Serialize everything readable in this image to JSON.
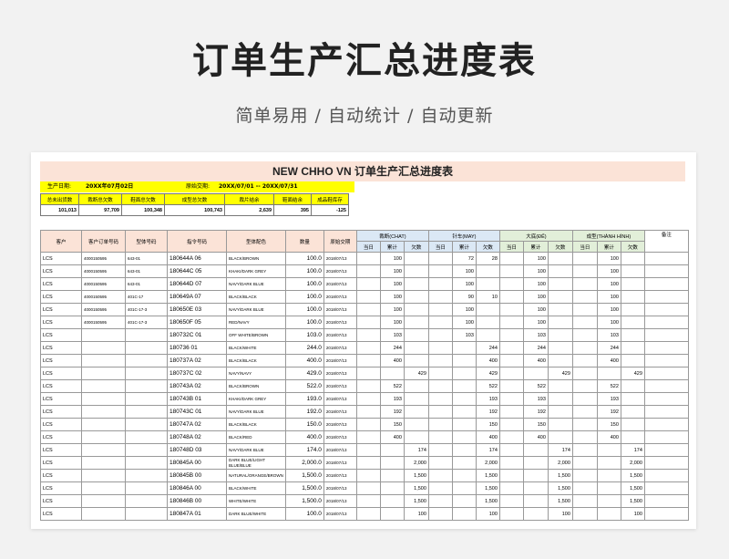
{
  "header": {
    "title": "订单生产汇总进度表",
    "subtitle": "简单易用  /  自动统计  /  自动更新"
  },
  "sheet": {
    "title": "NEW CHHO VN 订单生产汇总进度表",
    "info": {
      "date_label": "生产日期:",
      "date_value": "20XX年07月02日",
      "period_label": "原始交期:",
      "period_value": "20XX/07/01 -- 20XX/07/31"
    },
    "summary": {
      "headers": [
        "总未出货数",
        "裁断总欠数",
        "鞋面总欠数",
        "成型总欠数",
        "裁片结余",
        "鞋面结余",
        "成品鞋库存"
      ],
      "values": [
        "101,013",
        "97,709",
        "100,348",
        "100,743",
        "2,639",
        "395",
        "-125"
      ]
    },
    "table": {
      "headers": [
        "客户",
        "客户订单号码",
        "型体号码",
        "指令号码",
        "型体配色",
        "数量",
        "原始交期"
      ],
      "group_headers": [
        "裁断(CHAT)",
        "针车(MAY)",
        "大底(ĐẾ)",
        "成型(THÀNH HÌNH)"
      ],
      "last_header": "备注",
      "sub_headers": [
        "当日",
        "累计",
        "欠数"
      ],
      "rows": [
        {
          "customer": "LCS",
          "cust_po": "4000150595",
          "style": "643-01",
          "order": "180644A 06",
          "color": "BLACK/BROWN",
          "qty": "100.0",
          "date": "2018/07/13",
          "c": [
            "",
            "100",
            ""
          ],
          "m": [
            "",
            "72",
            "28"
          ],
          "d": [
            "",
            "100",
            ""
          ],
          "t": [
            "",
            "100",
            ""
          ]
        },
        {
          "customer": "LCS",
          "cust_po": "4000150595",
          "style": "643-01",
          "order": "180644C 05",
          "color": "KHAKI/DARK GREY",
          "qty": "100.0",
          "date": "2018/07/13",
          "c": [
            "",
            "100",
            ""
          ],
          "m": [
            "",
            "100",
            ""
          ],
          "d": [
            "",
            "100",
            ""
          ],
          "t": [
            "",
            "100",
            ""
          ]
        },
        {
          "customer": "LCS",
          "cust_po": "4000150595",
          "style": "643-01",
          "order": "180644D 07",
          "color": "NAVY/DARK BLUE",
          "qty": "100.0",
          "date": "2018/07/13",
          "c": [
            "",
            "100",
            ""
          ],
          "m": [
            "",
            "100",
            ""
          ],
          "d": [
            "",
            "100",
            ""
          ],
          "t": [
            "",
            "100",
            ""
          ]
        },
        {
          "customer": "LCS",
          "cust_po": "4000150595",
          "style": "401C-17",
          "order": "180649A 07",
          "color": "BLACK/BLACK",
          "qty": "100.0",
          "date": "2018/07/13",
          "c": [
            "",
            "100",
            ""
          ],
          "m": [
            "",
            "90",
            "10"
          ],
          "d": [
            "",
            "100",
            ""
          ],
          "t": [
            "",
            "100",
            ""
          ]
        },
        {
          "customer": "LCS",
          "cust_po": "4000150595",
          "style": "401C-17-3",
          "order": "180650E 03",
          "color": "NAVY/DARK BLUE",
          "qty": "100.0",
          "date": "2018/07/13",
          "c": [
            "",
            "100",
            ""
          ],
          "m": [
            "",
            "100",
            ""
          ],
          "d": [
            "",
            "100",
            ""
          ],
          "t": [
            "",
            "100",
            ""
          ]
        },
        {
          "customer": "LCS",
          "cust_po": "4000150595",
          "style": "401C-17-3",
          "order": "180650F 05",
          "color": "RED/NAVY",
          "qty": "100.0",
          "date": "2018/07/13",
          "c": [
            "",
            "100",
            ""
          ],
          "m": [
            "",
            "100",
            ""
          ],
          "d": [
            "",
            "100",
            ""
          ],
          "t": [
            "",
            "100",
            ""
          ]
        },
        {
          "customer": "LCS",
          "cust_po": "",
          "style": "",
          "order": "180732C 01",
          "color": "OFF WHITE/BROWN",
          "qty": "103.0",
          "date": "2018/07/13",
          "c": [
            "",
            "103",
            ""
          ],
          "m": [
            "",
            "103",
            ""
          ],
          "d": [
            "",
            "103",
            ""
          ],
          "t": [
            "",
            "103",
            ""
          ]
        },
        {
          "customer": "LCS",
          "cust_po": "",
          "style": "",
          "order": "180736 01",
          "color": "BLACK/WHITE",
          "qty": "244.0",
          "date": "2018/07/13",
          "c": [
            "",
            "244",
            ""
          ],
          "m": [
            "",
            "",
            "244"
          ],
          "d": [
            "",
            "244",
            ""
          ],
          "t": [
            "",
            "244",
            ""
          ]
        },
        {
          "customer": "LCS",
          "cust_po": "",
          "style": "",
          "order": "180737A 02",
          "color": "BLACK/BLACK",
          "qty": "400.0",
          "date": "2018/07/13",
          "c": [
            "",
            "400",
            ""
          ],
          "m": [
            "",
            "",
            "400"
          ],
          "d": [
            "",
            "400",
            ""
          ],
          "t": [
            "",
            "400",
            ""
          ]
        },
        {
          "customer": "LCS",
          "cust_po": "",
          "style": "",
          "order": "180737C 02",
          "color": "NAVY/NAVY",
          "qty": "429.0",
          "date": "2018/07/13",
          "c": [
            "",
            "",
            "429"
          ],
          "m": [
            "",
            "",
            "429"
          ],
          "d": [
            "",
            "",
            "429"
          ],
          "t": [
            "",
            "",
            "429"
          ]
        },
        {
          "customer": "LCS",
          "cust_po": "",
          "style": "",
          "order": "180743A 02",
          "color": "BLACK/BROWN",
          "qty": "522.0",
          "date": "2018/07/13",
          "c": [
            "",
            "522",
            ""
          ],
          "m": [
            "",
            "",
            "522"
          ],
          "d": [
            "",
            "522",
            ""
          ],
          "t": [
            "",
            "522",
            ""
          ]
        },
        {
          "customer": "LCS",
          "cust_po": "",
          "style": "",
          "order": "180743B 01",
          "color": "KHAKI/DARK GREY",
          "qty": "193.0",
          "date": "2018/07/13",
          "c": [
            "",
            "193",
            ""
          ],
          "m": [
            "",
            "",
            "193"
          ],
          "d": [
            "",
            "193",
            ""
          ],
          "t": [
            "",
            "193",
            ""
          ]
        },
        {
          "customer": "LCS",
          "cust_po": "",
          "style": "",
          "order": "180743C 01",
          "color": "NAVY/DARK BLUE",
          "qty": "192.0",
          "date": "2018/07/13",
          "c": [
            "",
            "192",
            ""
          ],
          "m": [
            "",
            "",
            "192"
          ],
          "d": [
            "",
            "192",
            ""
          ],
          "t": [
            "",
            "192",
            ""
          ]
        },
        {
          "customer": "LCS",
          "cust_po": "",
          "style": "",
          "order": "180747A 02",
          "color": "BLACK/BLACK",
          "qty": "150.0",
          "date": "2018/07/13",
          "c": [
            "",
            "150",
            ""
          ],
          "m": [
            "",
            "",
            "150"
          ],
          "d": [
            "",
            "150",
            ""
          ],
          "t": [
            "",
            "150",
            ""
          ]
        },
        {
          "customer": "LCS",
          "cust_po": "",
          "style": "",
          "order": "180748A 02",
          "color": "BLACK/RED",
          "qty": "400.0",
          "date": "2018/07/13",
          "c": [
            "",
            "400",
            ""
          ],
          "m": [
            "",
            "",
            "400"
          ],
          "d": [
            "",
            "400",
            ""
          ],
          "t": [
            "",
            "400",
            ""
          ]
        },
        {
          "customer": "LCS",
          "cust_po": "",
          "style": "",
          "order": "180748D 03",
          "color": "NAVY/DARK BLUE",
          "qty": "174.0",
          "date": "2018/07/13",
          "c": [
            "",
            "",
            "174"
          ],
          "m": [
            "",
            "",
            "174"
          ],
          "d": [
            "",
            "",
            "174"
          ],
          "t": [
            "",
            "",
            "174"
          ]
        },
        {
          "customer": "LCS",
          "cust_po": "",
          "style": "",
          "order": "180845A 00",
          "color": "DARK BLUE/LIGHT BLUE/BLUE",
          "qty": "2,000.0",
          "date": "2018/07/13",
          "c": [
            "",
            "",
            "2,000"
          ],
          "m": [
            "",
            "",
            "2,000"
          ],
          "d": [
            "",
            "",
            "2,000"
          ],
          "t": [
            "",
            "",
            "2,000"
          ]
        },
        {
          "customer": "LCS",
          "cust_po": "",
          "style": "",
          "order": "180845B 00",
          "color": "NATURAL/ORANGE/BROWN",
          "qty": "1,500.0",
          "date": "2018/07/13",
          "c": [
            "",
            "",
            "1,500"
          ],
          "m": [
            "",
            "",
            "1,500"
          ],
          "d": [
            "",
            "",
            "1,500"
          ],
          "t": [
            "",
            "",
            "1,500"
          ]
        },
        {
          "customer": "LCS",
          "cust_po": "",
          "style": "",
          "order": "180846A 00",
          "color": "BLACK/WHITE",
          "qty": "1,500.0",
          "date": "2018/07/13",
          "c": [
            "",
            "",
            "1,500"
          ],
          "m": [
            "",
            "",
            "1,500"
          ],
          "d": [
            "",
            "",
            "1,500"
          ],
          "t": [
            "",
            "",
            "1,500"
          ]
        },
        {
          "customer": "LCS",
          "cust_po": "",
          "style": "",
          "order": "180846B 00",
          "color": "WHITE/WHITE",
          "qty": "1,500.0",
          "date": "2018/07/13",
          "c": [
            "",
            "",
            "1,500"
          ],
          "m": [
            "",
            "",
            "1,500"
          ],
          "d": [
            "",
            "",
            "1,500"
          ],
          "t": [
            "",
            "",
            "1,500"
          ]
        },
        {
          "customer": "LCS",
          "cust_po": "",
          "style": "",
          "order": "180847A 01",
          "color": "DARK BLUE/WHITE",
          "qty": "100.0",
          "date": "2018/07/13",
          "c": [
            "",
            "",
            "100"
          ],
          "m": [
            "",
            "",
            "100"
          ],
          "d": [
            "",
            "",
            "100"
          ],
          "t": [
            "",
            "",
            "100"
          ]
        }
      ]
    }
  }
}
